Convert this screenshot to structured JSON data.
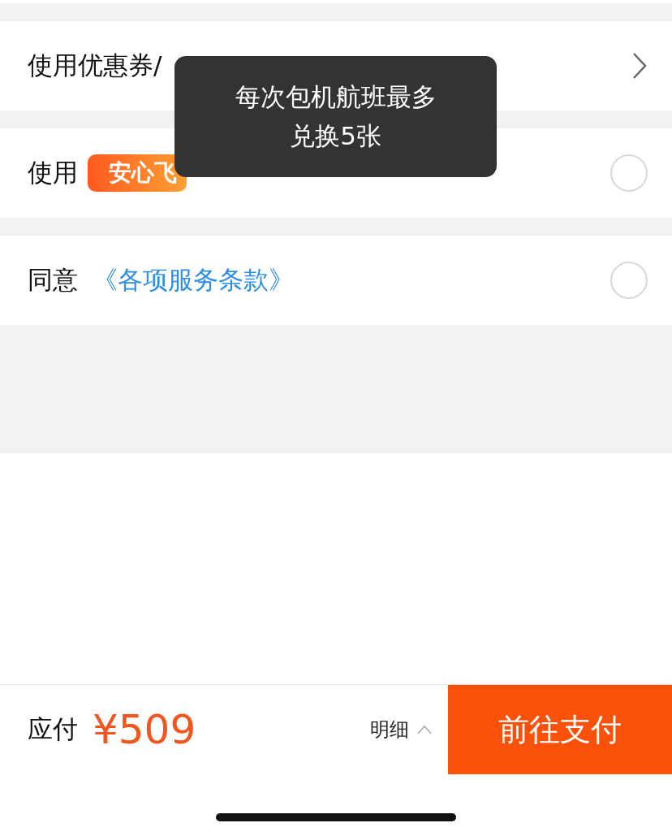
{
  "rows": [
    {
      "kind": "link",
      "label": "使用优惠券/"
    },
    {
      "kind": "radio",
      "label": "使用",
      "badge": "安心飞",
      "checked": false
    },
    {
      "kind": "radio",
      "label": "同意",
      "link": "《各项服务条款》",
      "checked": false
    }
  ],
  "tooltip": {
    "text": "每次包机航班最多兑换5张"
  },
  "footer": {
    "label": "应付",
    "price": "¥509",
    "details": "明细",
    "pay_button": "前往支付"
  }
}
